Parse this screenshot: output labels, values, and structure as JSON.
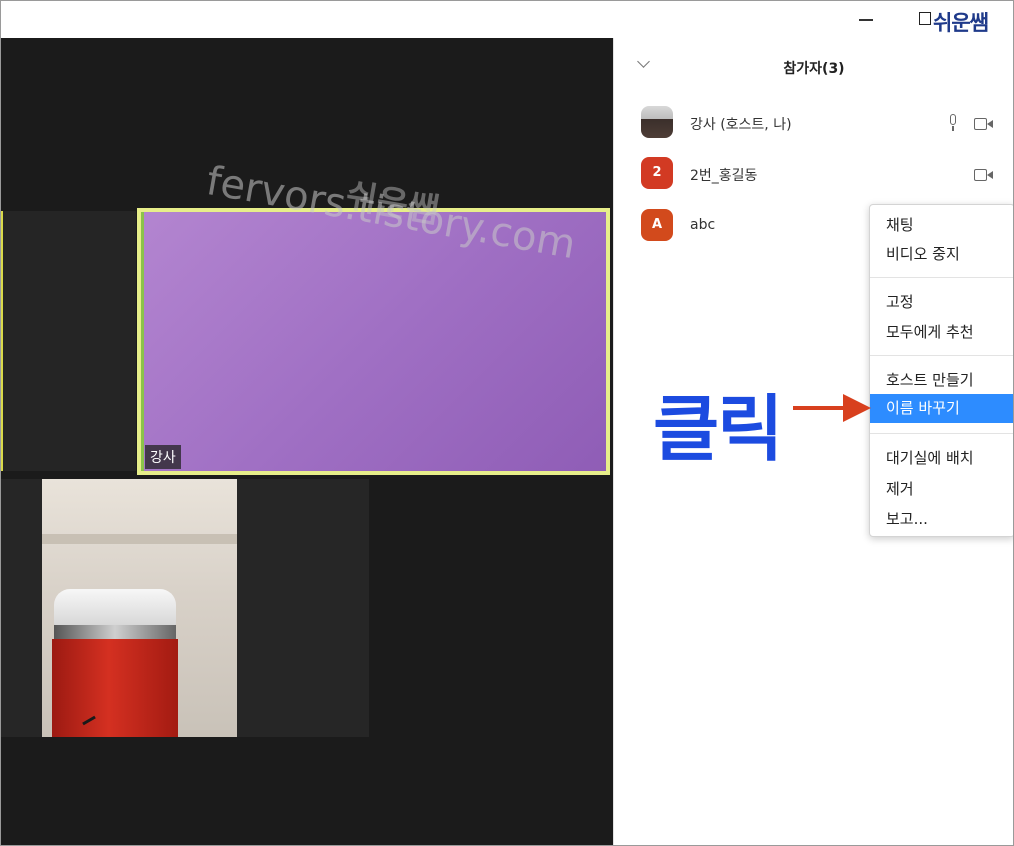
{
  "window": {
    "brand": "쉬운쌤",
    "minimize_icon": "minimize-icon",
    "maximize_icon": "maximize-icon"
  },
  "video": {
    "main_tile_name": "강사",
    "watermark_url": "fervors.tistory.com",
    "watermark_name": "쉬운쌤",
    "colors": {
      "main_tile_border": "#e7ee8a",
      "main_tile_bg": "#a070c4"
    }
  },
  "panel": {
    "title": "참가자(3)",
    "collapse_icon": "chevron-down-icon",
    "participants": [
      {
        "avatar": "",
        "name": "강사 (호스트, 나)",
        "avatar_type": "photo",
        "icons": [
          "mic-icon",
          "video-icon"
        ]
      },
      {
        "avatar": "2",
        "name": "2번_홍길동",
        "avatar_type": "initial",
        "avatar_color": "#d23a23",
        "icons": [
          "video-icon"
        ]
      },
      {
        "avatar": "A",
        "name": "abc",
        "avatar_type": "initial",
        "avatar_color": "#d24a1c",
        "icons": []
      }
    ]
  },
  "context_menu": {
    "items": [
      "채팅",
      "비디오 중지",
      "고정",
      "모두에게 추천",
      "호스트 만들기",
      "이름 바꾸기",
      "대기실에 배치",
      "제거",
      "보고..."
    ],
    "active_item": "이름 바꾸기",
    "active_color": "#2d8cff"
  },
  "annotation": {
    "label": "클릭",
    "label_color": "#1c4be0",
    "arrow_color": "#d8401e"
  }
}
